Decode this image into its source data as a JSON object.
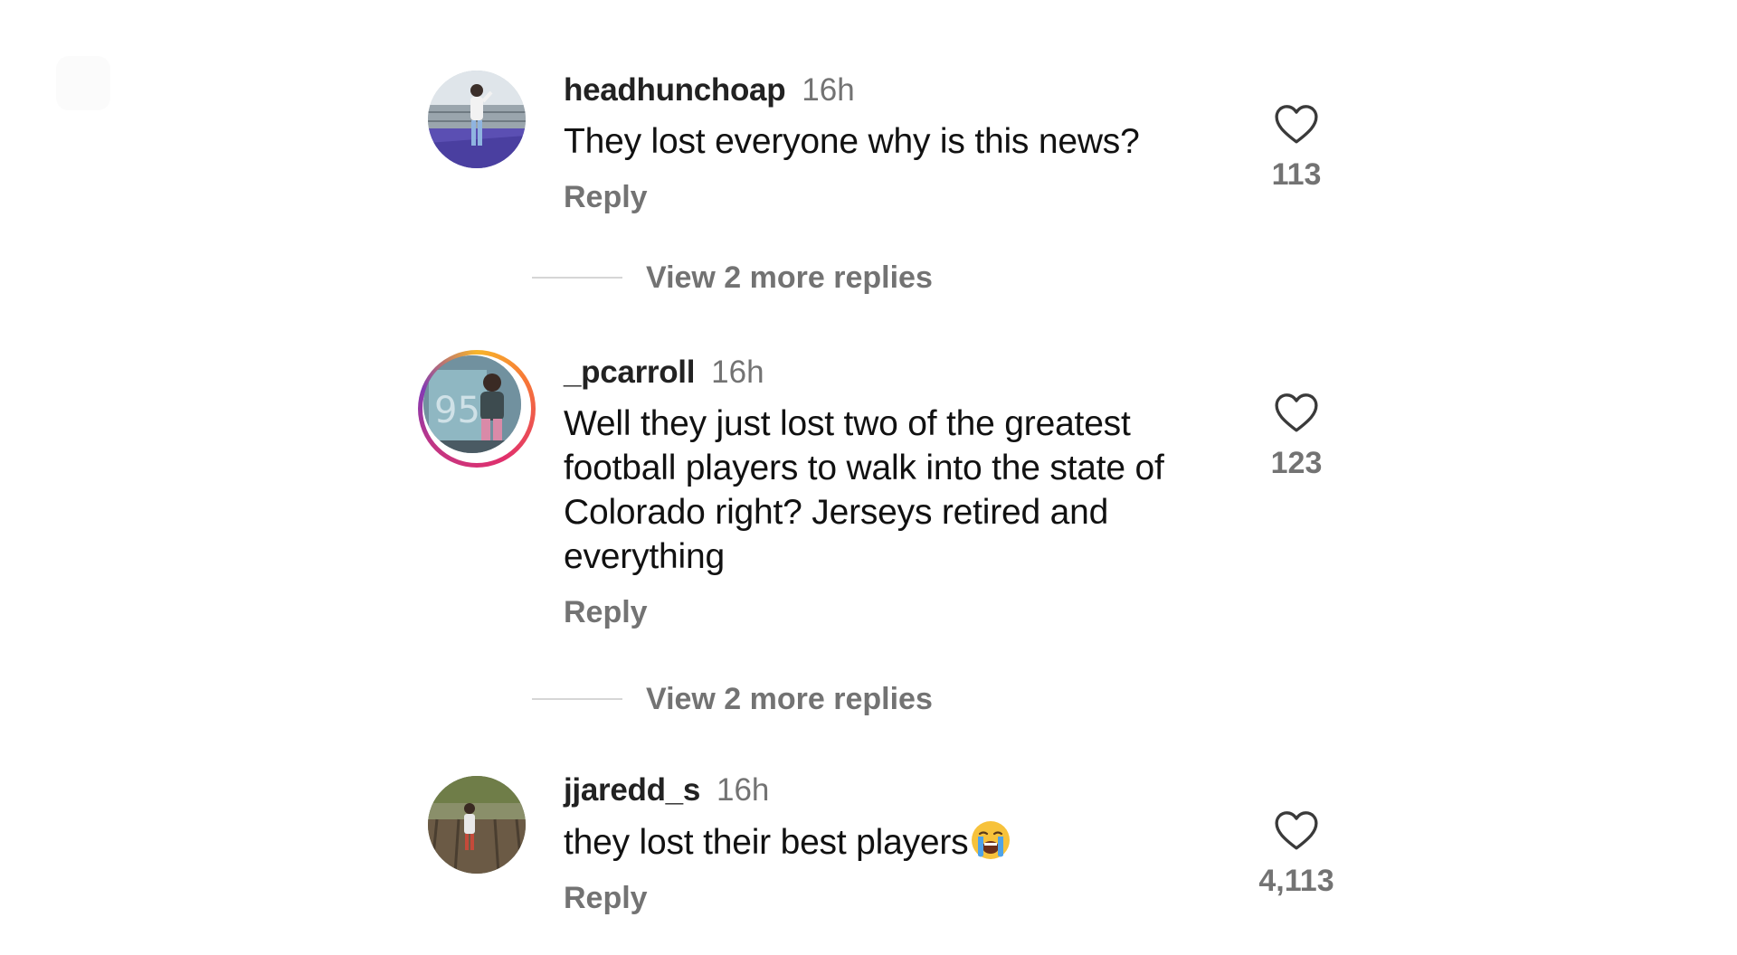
{
  "comments": [
    {
      "username": "headhunchoap",
      "time": "16h",
      "text": "They lost everyone why is this news?",
      "reply_label": "Reply",
      "like_count": "113",
      "view_replies_label": "View 2 more replies"
    },
    {
      "username": "_pcarroll",
      "time": "16h",
      "text": "Well they just lost two of the greatest football players to walk into the state of Colorado right? Jerseys retired and everything",
      "reply_label": "Reply",
      "like_count": "123",
      "view_replies_label": "View 2 more replies"
    },
    {
      "username": "jjaredd_s",
      "time": "16h",
      "text": "they lost their best players",
      "emoji": "loudly-crying-face-icon",
      "reply_label": "Reply",
      "like_count": "4,113"
    }
  ],
  "colors": {
    "username": "#222222",
    "secondary_text": "#737373",
    "story_ring": [
      "#f7b52a",
      "#e1306c",
      "#833ab4"
    ]
  }
}
